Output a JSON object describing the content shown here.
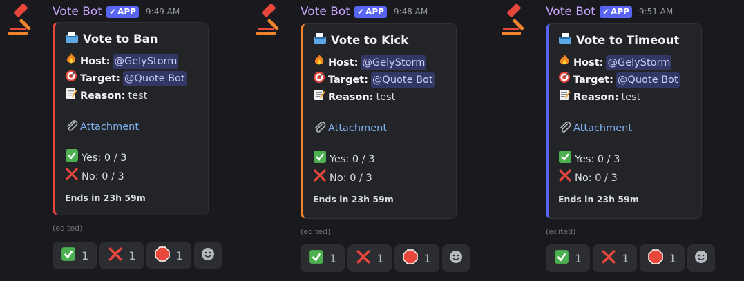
{
  "messages": [
    {
      "username": "Vote Bot",
      "badge": "APP",
      "timestamp": "9:49 AM",
      "accent": "#e8473c",
      "title": "Vote to Ban",
      "host_label": "Host:",
      "host_value": "@GelyStorm",
      "target_label": "Target:",
      "target_value": "@Quote Bot",
      "reason_label": "Reason:",
      "reason_value": "test",
      "attachment": "Attachment",
      "yes_text": "Yes: 0 / 3",
      "no_text": "No: 0 / 3",
      "footer": "Ends in 23h 59m",
      "edited": "(edited)",
      "reactions": [
        {
          "icon": "check-icon",
          "count": "1"
        },
        {
          "icon": "cross-icon",
          "count": "1"
        },
        {
          "icon": "stop-sign-icon",
          "count": "1"
        }
      ]
    },
    {
      "username": "Vote Bot",
      "badge": "APP",
      "timestamp": "9:48 AM",
      "accent": "#f0842c",
      "title": "Vote to Kick",
      "host_label": "Host:",
      "host_value": "@GelyStorm",
      "target_label": "Target:",
      "target_value": "@Quote Bot",
      "reason_label": "Reason:",
      "reason_value": "test",
      "attachment": "Attachment",
      "yes_text": "Yes: 0 / 3",
      "no_text": "No: 0 / 3",
      "footer": "Ends in 23h 59m",
      "edited": "(edited)",
      "reactions": [
        {
          "icon": "check-icon",
          "count": "1"
        },
        {
          "icon": "cross-icon",
          "count": "1"
        },
        {
          "icon": "stop-sign-icon",
          "count": "1"
        }
      ]
    },
    {
      "username": "Vote Bot",
      "badge": "APP",
      "timestamp": "9:51 AM",
      "accent": "#5865f2",
      "title": "Vote to Timeout",
      "host_label": "Host:",
      "host_value": "@GelyStorm",
      "target_label": "Target:",
      "target_value": "@Quote Bot",
      "reason_label": "Reason:",
      "reason_value": "test",
      "attachment": "Attachment",
      "yes_text": "Yes: 0 / 3",
      "no_text": "No: 0 / 3",
      "footer": "Ends in 23h 59m",
      "edited": "(edited)",
      "reactions": [
        {
          "icon": "check-icon",
          "count": "1"
        },
        {
          "icon": "cross-icon",
          "count": "1"
        },
        {
          "icon": "stop-sign-icon",
          "count": "1"
        }
      ]
    }
  ]
}
